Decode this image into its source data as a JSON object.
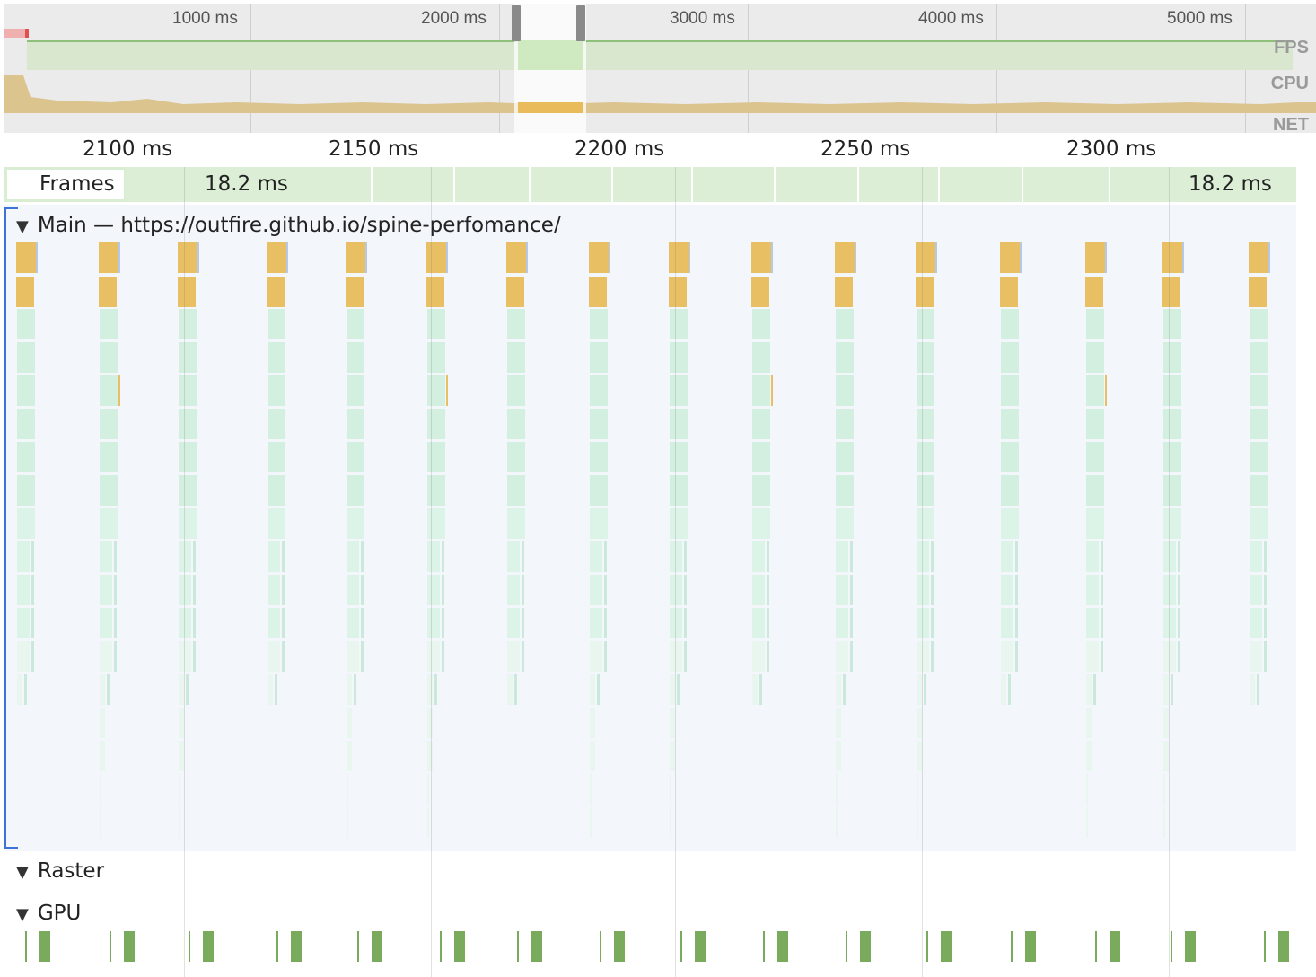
{
  "overview": {
    "ticks": [
      "1000 ms",
      "2000 ms",
      "3000 ms",
      "4000 ms",
      "5000 ms"
    ],
    "rows": {
      "fps": "FPS",
      "cpu": "CPU",
      "net": "NET"
    }
  },
  "ruler": {
    "ticks": [
      "2100 ms",
      "2150 ms",
      "2200 ms",
      "2250 ms",
      "2300 ms"
    ]
  },
  "frames": {
    "label": "Frames",
    "first_duration": "18.2 ms",
    "last_duration": "18.2 ms"
  },
  "main": {
    "title": "Main — https://outfire.github.io/spine-perfomance/"
  },
  "raster": {
    "title": "Raster"
  },
  "gpu": {
    "title": "GPU"
  },
  "colors": {
    "scripting": "#e8c063",
    "rendering_pale": "#d5efe2",
    "frame_green": "#dcefd6",
    "gpu_green": "#7aab5c",
    "cpu_area": "#dcc48f",
    "selection_blue": "#3b73d9"
  }
}
